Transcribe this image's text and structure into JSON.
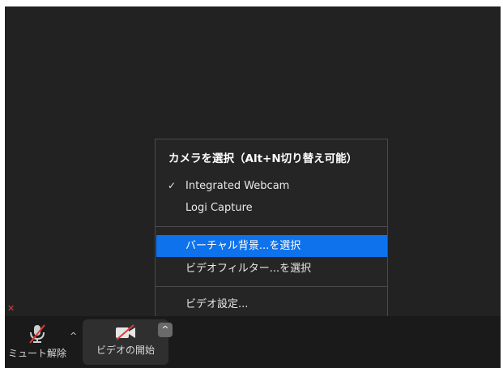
{
  "camera_menu": {
    "title": "カメラを選択（Alt+N切り替え可能）",
    "cameras": [
      {
        "label": "Integrated Webcam",
        "checked": true
      },
      {
        "label": "Logi Capture",
        "checked": false
      }
    ],
    "actions": [
      {
        "label": "バーチャル背景...を選択",
        "highlighted": true
      },
      {
        "label": "ビデオフィルター...を選択",
        "highlighted": false
      }
    ],
    "settings_label": "ビデオ設定...",
    "check_glyph": "✓",
    "highlight_color": "#0e72ed"
  },
  "toolbar": {
    "mute": {
      "label": "ミュート解除",
      "icon": "muted-microphone-icon",
      "caret": "^"
    },
    "video": {
      "label": "ビデオの開始",
      "icon": "video-off-icon",
      "caret": "^"
    }
  },
  "colors": {
    "stage_bg": "#222222",
    "toolbar_bg": "#1a1a1a",
    "strike_red": "#e03a3a"
  }
}
